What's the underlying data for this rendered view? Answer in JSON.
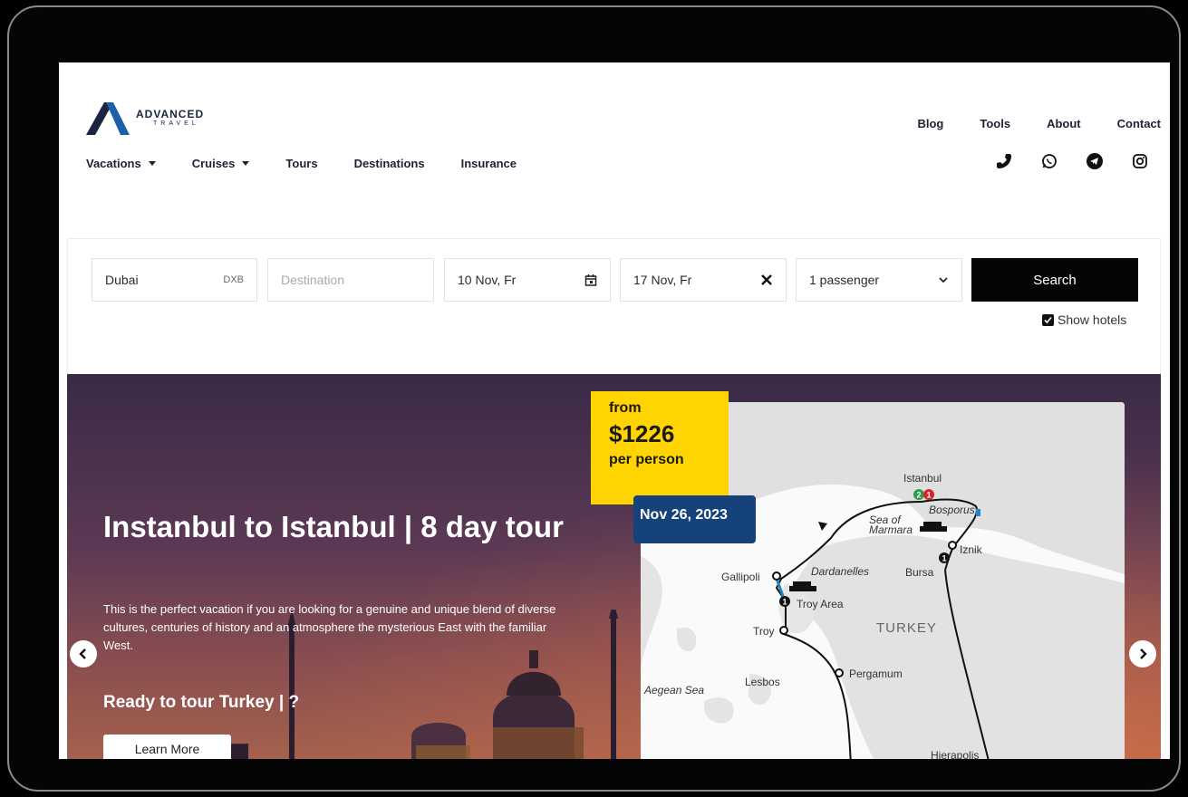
{
  "brand": {
    "name": "ADVANCED",
    "tagline": "TRAVEL"
  },
  "top_links": [
    "Blog",
    "Tools",
    "About",
    "Contact"
  ],
  "main_nav": [
    {
      "label": "Vacations",
      "dropdown": true
    },
    {
      "label": "Cruises",
      "dropdown": true
    },
    {
      "label": "Tours",
      "dropdown": false
    },
    {
      "label": "Destinations",
      "dropdown": false
    },
    {
      "label": "Insurance",
      "dropdown": false
    }
  ],
  "social_icons": [
    "phone-icon",
    "whatsapp-icon",
    "telegram-icon",
    "instagram-icon"
  ],
  "search": {
    "origin_value": "Dubai",
    "origin_code": "DXB",
    "destination_placeholder": "Destination",
    "depart_date": "10 Nov, Fr",
    "return_date": "17 Nov, Fr",
    "passengers": "1 passenger",
    "search_label": "Search",
    "show_hotels_label": "Show hotels",
    "show_hotels_checked": true
  },
  "hero": {
    "title": "Instanbul to Istanbul | 8 day tour",
    "description": "This is the perfect vacation if you are looking for a genuine and unique blend of diverse cultures, centuries of history and an atmosphere the mysterious East with the familiar West.",
    "subtitle": "Ready to tour Turkey | ?",
    "cta_label": "Learn More",
    "price": {
      "from": "from",
      "amount": "$1226",
      "per": "per person"
    },
    "date_badge": "Nov 26, 2023"
  },
  "map": {
    "labels": {
      "istanbul": "Istanbul",
      "bosporus": "Bosporus",
      "sea_of_marmara": "Sea of Marmara",
      "iznik": "Iznik",
      "gallipoli": "Gallipoli",
      "dardanelles": "Dardanelles",
      "bursa": "Bursa",
      "troy_area": "Troy Area",
      "turkey": "TURKEY",
      "troy": "Troy",
      "pergamum": "Pergamum",
      "aegean_sea": "Aegean Sea",
      "lesbos": "Lesbos",
      "hierapolis": "Hierapolis"
    },
    "markers": {
      "green": "2",
      "red": "1",
      "iznik": "1",
      "troy_area": "1"
    }
  },
  "colors": {
    "accent_yellow": "#ffd400",
    "badge_blue": "#15427a",
    "button_black": "#050505"
  }
}
